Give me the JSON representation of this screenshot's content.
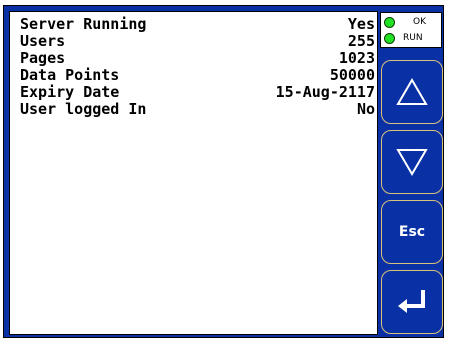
{
  "info_rows": [
    {
      "label": "Server Running",
      "value": "Yes"
    },
    {
      "label": "Users",
      "value": "255"
    },
    {
      "label": "Pages",
      "value": "1023"
    },
    {
      "label": "Data Points",
      "value": "50000"
    },
    {
      "label": "Expiry Date",
      "value": "15-Aug-2117"
    },
    {
      "label": "User logged In",
      "value": "No"
    }
  ],
  "status": {
    "ok_label": "OK",
    "run_label": "RUN",
    "led_color": "#22e022"
  },
  "buttons": {
    "up_icon": "up-triangle-icon",
    "down_icon": "down-triangle-icon",
    "esc_label": "Esc",
    "enter_icon": "enter-arrow-icon"
  },
  "colors": {
    "frame": "#0a30a6",
    "button_border": "#d8c27a",
    "panel": "#ffffff"
  }
}
